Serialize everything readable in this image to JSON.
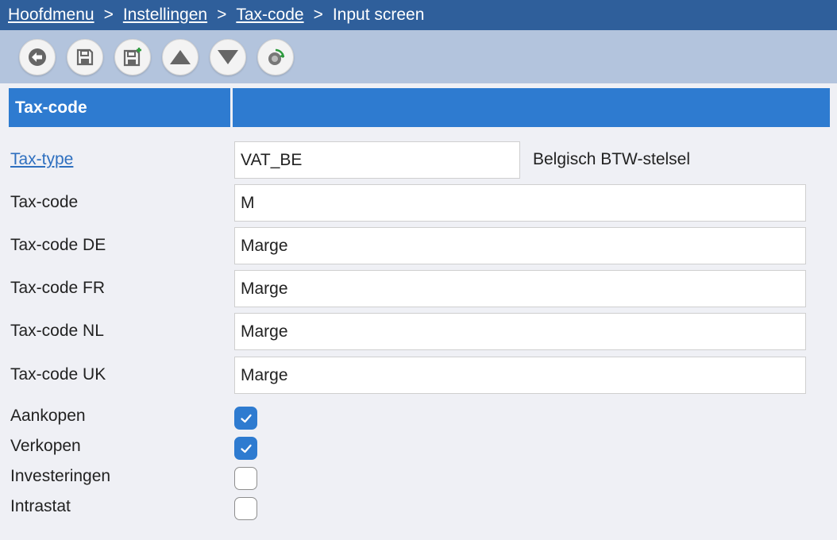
{
  "breadcrumb": {
    "items": [
      "Hoofdmenu",
      "Instellingen",
      "Tax-code"
    ],
    "current": "Input screen",
    "separator": ">"
  },
  "toolbar": {
    "buttons": [
      "back-arrow-icon",
      "save-icon",
      "save-new-icon",
      "move-up-icon",
      "move-down-icon",
      "refresh-icon"
    ]
  },
  "section": {
    "title": "Tax-code",
    "right_title": ""
  },
  "form": {
    "tax_type": {
      "label": "Tax-type",
      "value": "VAT_BE",
      "description": "Belgisch BTW-stelsel"
    },
    "tax_code": {
      "label": "Tax-code",
      "value": "M"
    },
    "tax_code_de": {
      "label": "Tax-code DE",
      "value": "Marge"
    },
    "tax_code_fr": {
      "label": "Tax-code FR",
      "value": "Marge"
    },
    "tax_code_nl": {
      "label": "Tax-code NL",
      "value": "Marge"
    },
    "tax_code_uk": {
      "label": "Tax-code UK",
      "value": "Marge"
    },
    "checkboxes": [
      {
        "label": "Aankopen",
        "checked": true
      },
      {
        "label": "Verkopen",
        "checked": true
      },
      {
        "label": "Investeringen",
        "checked": false
      },
      {
        "label": "Intrastat",
        "checked": false
      }
    ]
  },
  "colors": {
    "breadcrumb_bg": "#2f5f9b",
    "toolbar_bg": "#b3c4dd",
    "section_bg": "#2e7bd0",
    "link": "#2e6fbf",
    "checkbox_on": "#2e7bd0"
  }
}
